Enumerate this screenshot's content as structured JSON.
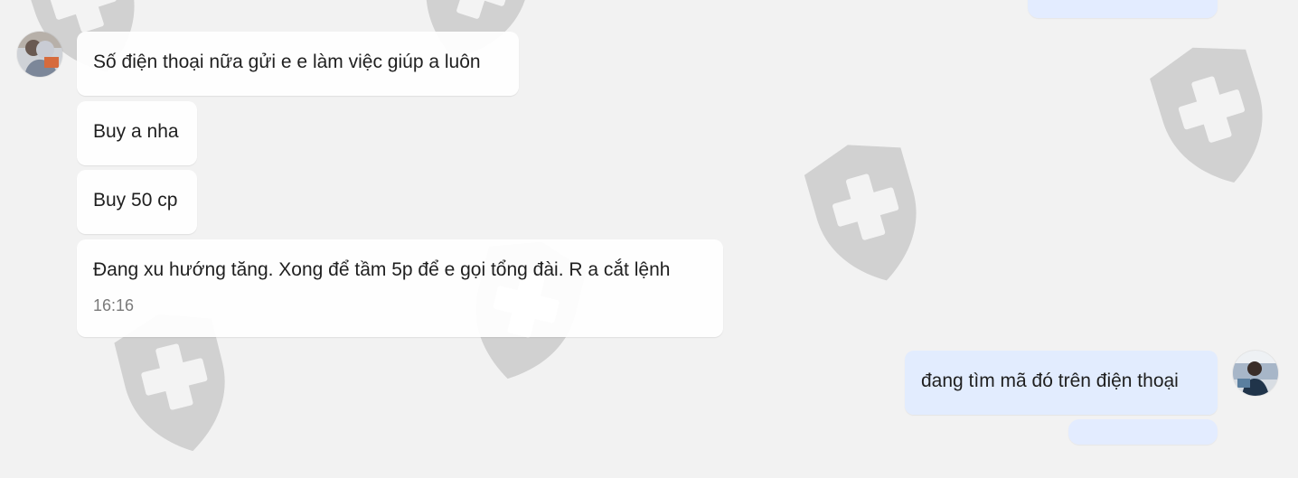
{
  "chat": {
    "messages": [
      {
        "sender": "incoming",
        "text": "Số điện thoại nữa gửi e e làm việc giúp a luôn"
      },
      {
        "sender": "incoming",
        "text": "Buy a nha"
      },
      {
        "sender": "incoming",
        "text": "Buy 50 cp"
      },
      {
        "sender": "incoming",
        "text": "Đang xu hướng tăng. Xong để tầm 5p để e gọi tổng đài. R a cắt lệnh",
        "time": "16:16"
      },
      {
        "sender": "outgoing",
        "text": "đang tìm mã đó trên điện thoại"
      }
    ]
  },
  "ui": {
    "background_color": "#f2f2f2",
    "incoming_bubble_color": "#ffffff",
    "outgoing_bubble_color": "#e1ebff",
    "watermark_color": "#cfcfcf",
    "watermark_icon": "shield-plus-icon",
    "incoming_avatar_icon": "user-avatar-icon",
    "outgoing_avatar_icon": "user-avatar-icon"
  }
}
